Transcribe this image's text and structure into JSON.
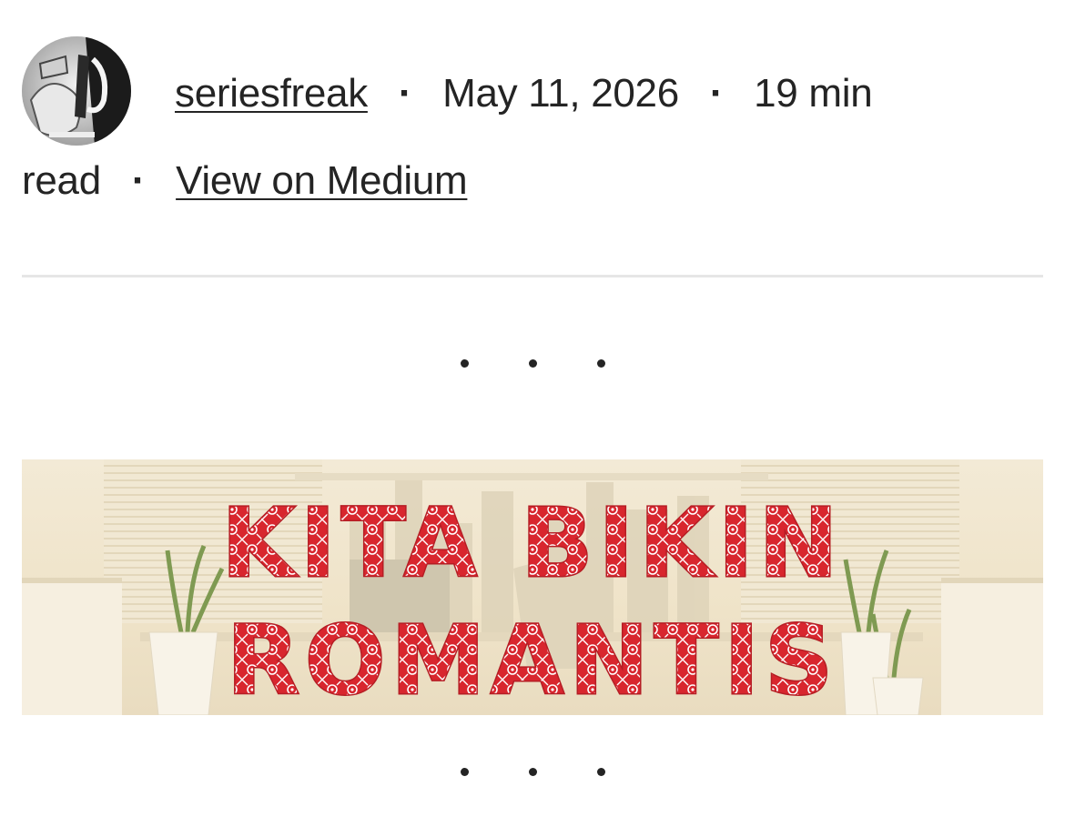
{
  "author": {
    "username": "seriesfreak",
    "avatar_icon": "author-avatar"
  },
  "post_meta": {
    "date": "May 11, 2026",
    "read_time_part1": "19 min",
    "read_time_part2": "read",
    "separator_glyph": "·",
    "view_link_label": "View on Medium"
  },
  "banner": {
    "title_line1": "KITA BIKIN",
    "title_line2": "ROMANTIS",
    "title_color": "#d8262e"
  },
  "colors": {
    "text": "#242424",
    "divider": "#e6e6e6",
    "banner_bg": "#f2e7cf"
  }
}
